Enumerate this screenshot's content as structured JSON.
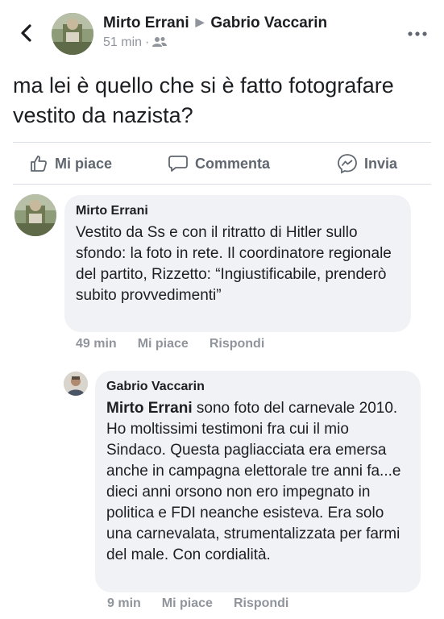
{
  "header": {
    "author": "Mirto Errani",
    "target": "Gabrio Vaccarin",
    "time": "51 min",
    "separator": "·",
    "audience_icon": "friends-icon"
  },
  "post": {
    "text": "ma lei è quello che si è fatto fotografare vestito da nazista?"
  },
  "actions": {
    "like": "Mi piace",
    "comment": "Commenta",
    "send": "Invia"
  },
  "comments": [
    {
      "author": "Mirto Errani",
      "text": "Vestito da Ss e con il ritratto di Hitler sullo sfondo: la foto in rete. Il coordinatore regionale del partito, Rizzetto: “Ingiustificabile, prenderò subito provvedimenti”",
      "time": "49 min",
      "like": "Mi piace",
      "reply": "Rispondi"
    },
    {
      "author": "Gabrio Vaccarin",
      "mention": "Mirto Errani",
      "text": " sono foto del carnevale 2010. Ho moltissimi testimoni fra cui il mio Sindaco. Questa pagliacciata era emersa anche in campagna elettorale tre anni fa...e dieci anni orsono non ero impegnato in politica e FDI neanche esisteva.  Era solo una carnevalata, strumentalizzata per farmi del male. Con cordialità.",
      "time": "9 min",
      "like": "Mi piace",
      "reply": "Rispondi"
    }
  ]
}
